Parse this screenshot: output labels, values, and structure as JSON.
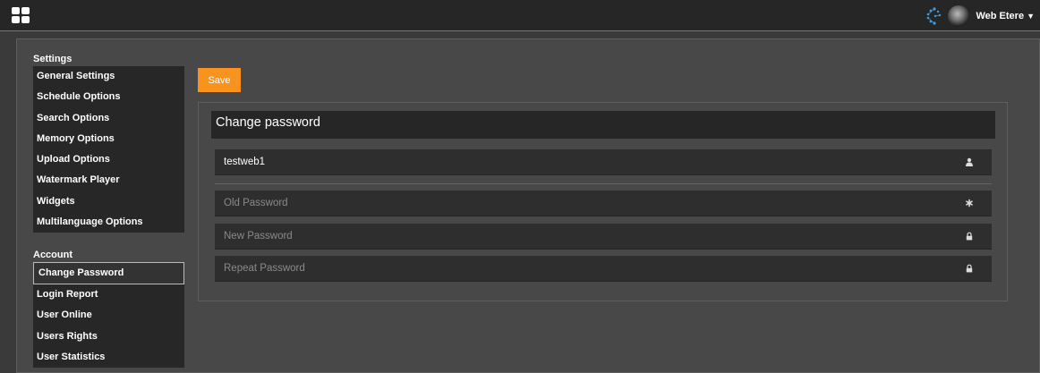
{
  "header": {
    "username": "Web Etere",
    "menu_icon": "grid-icon",
    "user_caret": "chevron-down-icon"
  },
  "sidebar": {
    "settings_title": "Settings",
    "settings_items": [
      {
        "label": "General Settings"
      },
      {
        "label": "Schedule Options"
      },
      {
        "label": "Search Options"
      },
      {
        "label": "Memory Options"
      },
      {
        "label": "Upload Options"
      },
      {
        "label": "Watermark Player"
      },
      {
        "label": "Widgets"
      },
      {
        "label": "Multilanguage Options"
      }
    ],
    "account_title": "Account",
    "account_items": [
      {
        "label": "Change Password",
        "active": true
      },
      {
        "label": "Login Report"
      },
      {
        "label": "User Online"
      },
      {
        "label": "Users Rights"
      },
      {
        "label": "User Statistics"
      }
    ]
  },
  "toolbar": {
    "save_label": "Save"
  },
  "colors": {
    "accent": "#f7931e",
    "background": "#3a3a3a",
    "panel": "#2e2e2e"
  },
  "change_password": {
    "title": "Change password",
    "username_value": "testweb1",
    "username_icon": "user-icon",
    "old_password_placeholder": "Old Password",
    "old_password_icon": "asterisk-icon",
    "new_password_placeholder": "New Password",
    "new_password_icon": "lock-icon",
    "repeat_password_placeholder": "Repeat Password",
    "repeat_password_icon": "lock-icon"
  }
}
